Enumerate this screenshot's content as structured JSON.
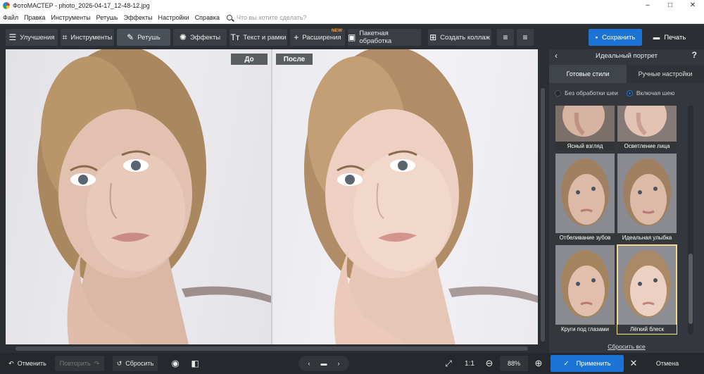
{
  "window": {
    "title": "ФотоМАСТЕР - photo_2026-04-17_12-48-12.jpg",
    "controls": [
      "–",
      "□",
      "✕"
    ]
  },
  "menu": {
    "items": [
      "Файл",
      "Правка",
      "Инструменты",
      "Ретушь",
      "Эффекты",
      "Настройки",
      "Справка"
    ],
    "search_placeholder": "Что вы хотите сделать?"
  },
  "toolbar": {
    "tabs": [
      {
        "label": "Улучшения",
        "icon": "sliders-icon"
      },
      {
        "label": "Инструменты",
        "icon": "crop-icon"
      },
      {
        "label": "Ретушь",
        "icon": "brush-icon",
        "active": true
      },
      {
        "label": "Эффекты",
        "icon": "sparkle-icon"
      },
      {
        "label": "Текст и рамки",
        "icon": "text-icon"
      },
      {
        "label": "Расширения",
        "icon": "plus-icon",
        "badge": "NEW"
      },
      {
        "label": "Пакетная обработка",
        "icon": "image-icon"
      },
      {
        "label": "Создать коллаж",
        "icon": "collage-icon"
      }
    ],
    "save_label": "Сохранить",
    "print_label": "Печать"
  },
  "preview": {
    "before_label": "До",
    "after_label": "После"
  },
  "panel": {
    "title": "Идеальный портрет",
    "help": "?",
    "tab_styles": "Готовые стили",
    "tab_manual": "Ручные настройки",
    "radio_no_neck": "Без обработки шеи",
    "radio_with_neck": "Включая шею",
    "selected_radio": "Включая шею",
    "presets": [
      "Ясный взгляд",
      "Осветление лица",
      "Отбеливание зубов",
      "Идеальная улыбка",
      "Круги под глазами",
      "Лёгкий блеск"
    ],
    "selected_preset": "Лёгкий блеск",
    "reset_all": "Сбросить все"
  },
  "bottom": {
    "undo": "Отменить",
    "redo": "Повторить",
    "reset": "Сбросить",
    "ratio": "1:1",
    "zoom": "88%",
    "apply": "Применить",
    "cancel": "Отмена"
  },
  "colors": {
    "accent": "#1b74d4",
    "background": "#2b2e33",
    "panel": "#34383e",
    "badge": "#f29b3a",
    "selection_outline": "#f0d98a"
  }
}
